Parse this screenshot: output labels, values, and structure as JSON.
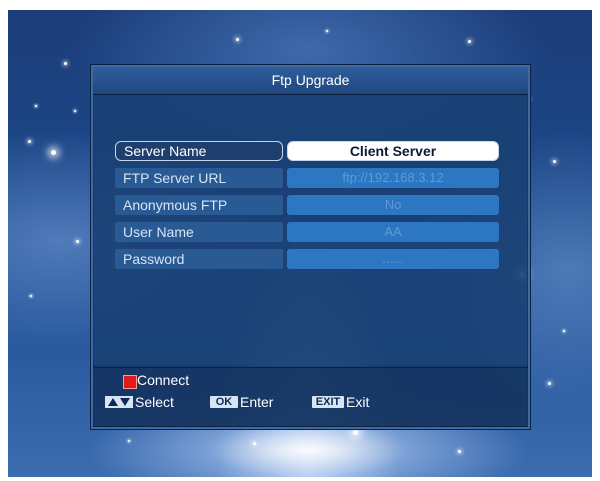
{
  "dialog": {
    "title": "Ftp Upgrade",
    "rows": [
      {
        "label": "Server Name",
        "value": "Client Server"
      },
      {
        "label": "FTP Server URL",
        "value": "ftp://192.168.3.12"
      },
      {
        "label": "Anonymous FTP",
        "value": "No"
      },
      {
        "label": "User Name",
        "value": "AA"
      },
      {
        "label": "Password",
        "value": "......"
      }
    ]
  },
  "footer": {
    "connect_label": "Connect",
    "select_label": "Select",
    "ok_key": "OK",
    "enter_label": "Enter",
    "exit_key": "EXIT",
    "exit_label": "Exit"
  },
  "colors": {
    "background": "#1d4a8c",
    "accent_red": "#e11b1b",
    "selected_value_bg": "#ffffff",
    "field_bg": "#2d76c2"
  }
}
